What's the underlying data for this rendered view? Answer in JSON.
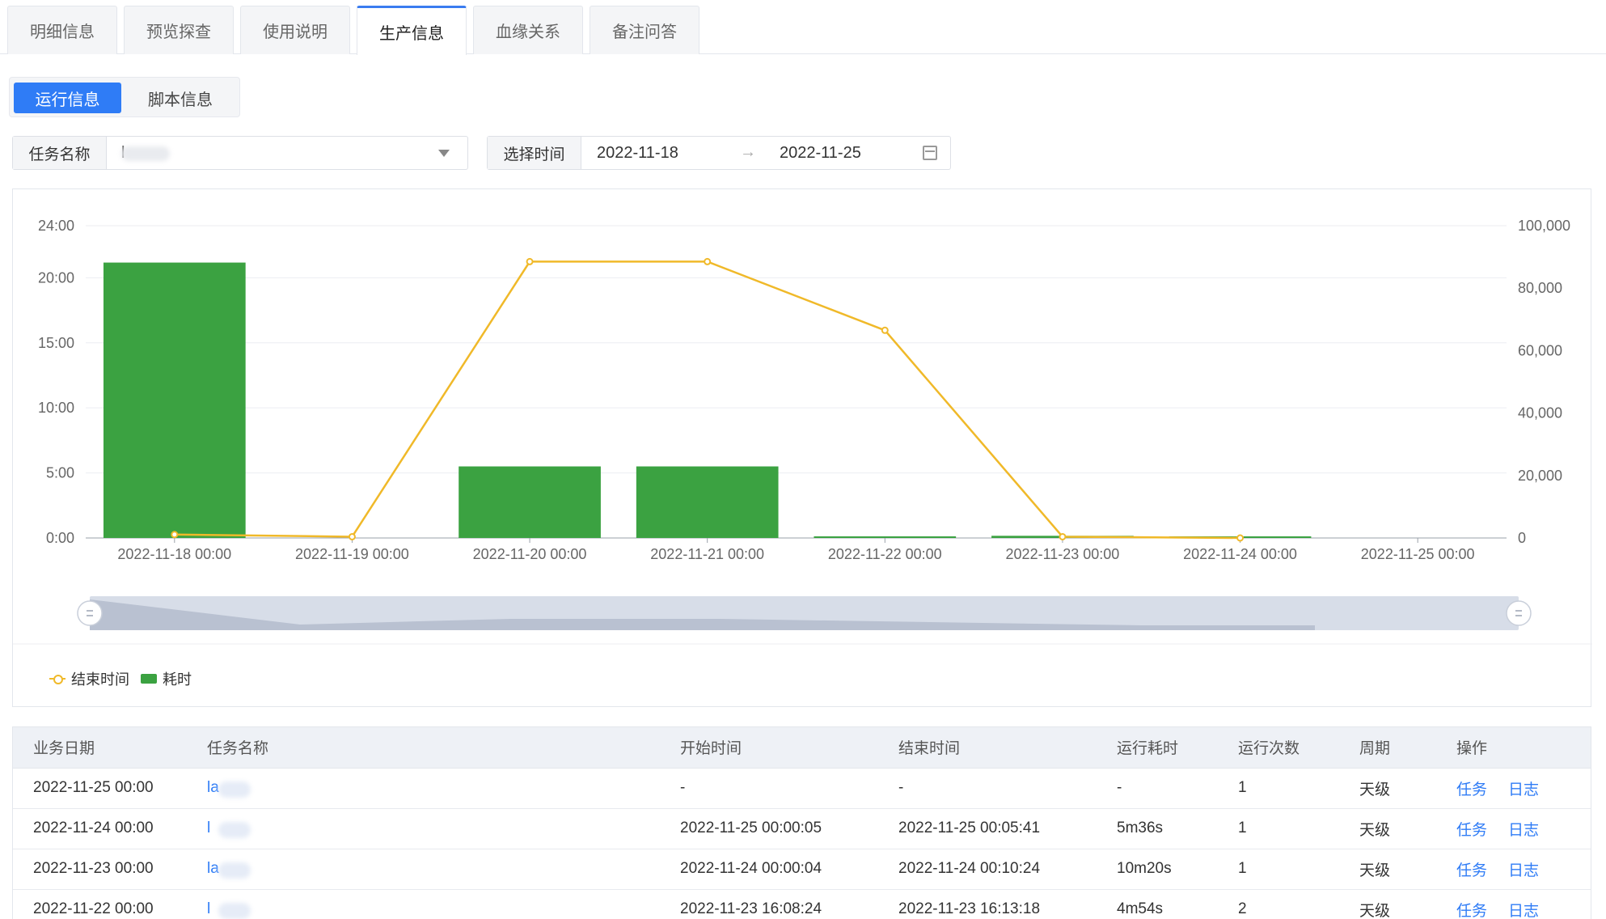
{
  "tabs": [
    {
      "label": "明细信息",
      "active": false
    },
    {
      "label": "预览探查",
      "active": false
    },
    {
      "label": "使用说明",
      "active": false
    },
    {
      "label": "生产信息",
      "active": true
    },
    {
      "label": "血缘关系",
      "active": false
    },
    {
      "label": "备注问答",
      "active": false
    }
  ],
  "subtabs": {
    "run_info": "运行信息",
    "script_info": "脚本信息"
  },
  "filters": {
    "task_label": "任务名称",
    "task_value": "l",
    "time_label": "选择时间",
    "start_date": "2022-11-18",
    "arrow": "→",
    "end_date": "2022-11-25"
  },
  "chart_data": {
    "type": "bar+line",
    "categories": [
      "2022-11-18 00:00",
      "2022-11-19 00:00",
      "2022-11-20 00:00",
      "2022-11-21 00:00",
      "2022-11-22 00:00",
      "2022-11-23 00:00",
      "2022-11-24 00:00",
      "2022-11-25 00:00"
    ],
    "left_axis": {
      "ticks": [
        "0:00",
        "5:00",
        "10:00",
        "15:00",
        "20:00",
        "24:00"
      ],
      "tick_minutes": [
        0,
        300,
        600,
        900,
        1200,
        1440
      ],
      "max_minutes": 1440
    },
    "right_axis": {
      "ticks": [
        "0",
        "20,000",
        "40,000",
        "60,000",
        "80,000",
        "100,000"
      ],
      "tick_values": [
        0,
        20000,
        40000,
        60000,
        80000,
        100000
      ],
      "max": 100000
    },
    "series": [
      {
        "name": "耗时",
        "kind": "bar",
        "axis": "left",
        "color": "#3ba241",
        "values_minutes": [
          1270,
          0,
          330,
          330,
          3,
          10,
          4.9,
          0
        ]
      },
      {
        "name": "结束时间",
        "kind": "line",
        "axis": "right",
        "color": "#f0b929",
        "values": [
          1100,
          400,
          88500,
          88500,
          66500,
          400,
          0,
          null
        ]
      }
    ],
    "legend": [
      "结束时间",
      "耗时"
    ],
    "legend_position": "bottom-left",
    "grid": true,
    "datazoom": true
  },
  "table": {
    "headers": [
      "业务日期",
      "任务名称",
      "开始时间",
      "结束时间",
      "运行耗时",
      "运行次数",
      "周期",
      "操作"
    ],
    "rows": [
      {
        "date": "2022-11-25 00:00",
        "name": "la",
        "start": "-",
        "end": "-",
        "duration": "-",
        "runs": "1",
        "cycle": "天级",
        "op_task": "任务",
        "op_log": "日志"
      },
      {
        "date": "2022-11-24 00:00",
        "name": "l",
        "start": "2022-11-25 00:00:05",
        "end": "2022-11-25 00:05:41",
        "duration": "5m36s",
        "runs": "1",
        "cycle": "天级",
        "op_task": "任务",
        "op_log": "日志"
      },
      {
        "date": "2022-11-23 00:00",
        "name": "la",
        "start": "2022-11-24 00:00:04",
        "end": "2022-11-24 00:10:24",
        "duration": "10m20s",
        "runs": "1",
        "cycle": "天级",
        "op_task": "任务",
        "op_log": "日志"
      },
      {
        "date": "2022-11-22 00:00",
        "name": "l",
        "start": "2022-11-23 16:08:24",
        "end": "2022-11-23 16:13:18",
        "duration": "4m54s",
        "runs": "2",
        "cycle": "天级",
        "op_task": "任务",
        "op_log": "日志"
      }
    ]
  }
}
